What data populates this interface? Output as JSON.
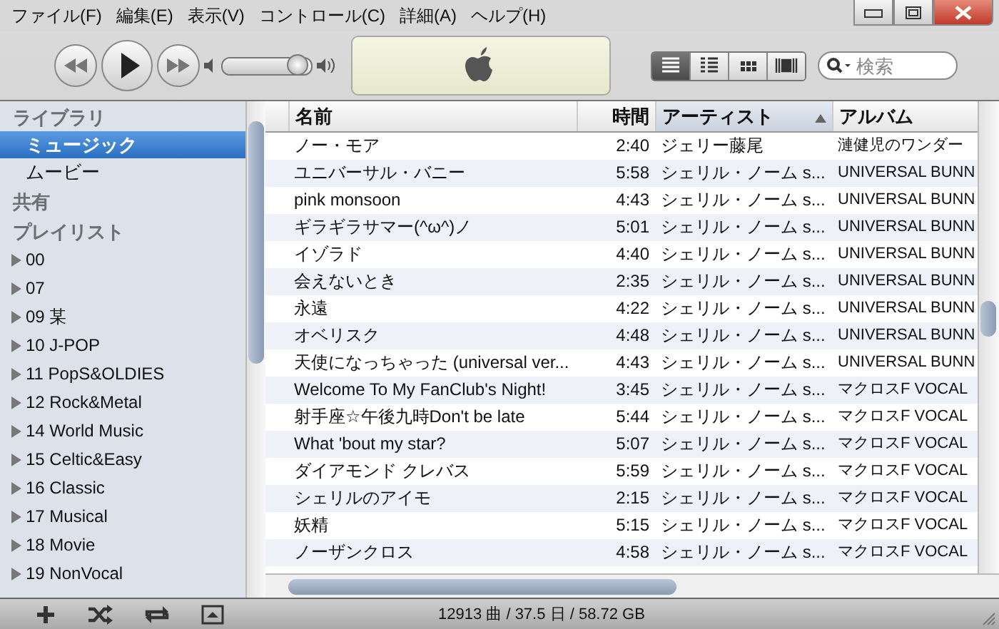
{
  "menu": [
    "ファイル(F)",
    "編集(E)",
    "表示(V)",
    "コントロール(C)",
    "詳細(A)",
    "ヘルプ(H)"
  ],
  "volume": {
    "level": 0.86
  },
  "view_buttons": [
    {
      "selected": true
    },
    {
      "selected": false
    },
    {
      "selected": false
    },
    {
      "selected": false
    }
  ],
  "search": {
    "placeholder": "検索"
  },
  "sidebar": {
    "sections": [
      {
        "title": "ライブラリ",
        "items": [
          {
            "label": "ミュージック",
            "selected": true
          },
          {
            "label": "ムービー",
            "selected": false
          }
        ]
      },
      {
        "title": "共有"
      },
      {
        "title": "プレイリスト",
        "items": [
          {
            "label": "00",
            "selected": false,
            "expanded": false
          },
          {
            "label": "07",
            "selected": false,
            "expanded": false
          },
          {
            "label": "09 某",
            "selected": false,
            "expanded": false
          },
          {
            "label": "10 J-POP",
            "selected": false,
            "expanded": false
          },
          {
            "label": "11 PopS&OLDIES",
            "selected": false,
            "expanded": false
          },
          {
            "label": "12 Rock&Metal",
            "selected": false,
            "expanded": false
          },
          {
            "label": "14 World Music",
            "selected": false,
            "expanded": false
          },
          {
            "label": "15 Celtic&Easy",
            "selected": false,
            "expanded": false
          },
          {
            "label": "16 Classic",
            "selected": false,
            "expanded": false
          },
          {
            "label": "17 Musical",
            "selected": false,
            "expanded": false
          },
          {
            "label": "18 Movie",
            "selected": false,
            "expanded": false
          },
          {
            "label": "19 NonVocal",
            "selected": false,
            "expanded": false
          }
        ]
      }
    ]
  },
  "table": {
    "columns": [
      {
        "label": "名前",
        "sorted": false
      },
      {
        "label": "時間",
        "sorted": false
      },
      {
        "label": "アーティスト",
        "sorted": true
      },
      {
        "label": "アルバム",
        "sorted": false
      }
    ],
    "rows": [
      [
        "ノー・モア",
        "2:40",
        "ジェリー藤尾",
        "漣健児のワンダー"
      ],
      [
        "ユニバーサル・バニー",
        "5:58",
        "シェリル・ノーム s...",
        "UNIVERSAL BUNN"
      ],
      [
        "pink monsoon",
        "4:43",
        "シェリル・ノーム s...",
        "UNIVERSAL BUNN"
      ],
      [
        "ギラギラサマー(^ω^)ノ",
        "5:01",
        "シェリル・ノーム s...",
        "UNIVERSAL BUNN"
      ],
      [
        "イゾラド",
        "4:40",
        "シェリル・ノーム s...",
        "UNIVERSAL BUNN"
      ],
      [
        "会えないとき",
        "2:35",
        "シェリル・ノーム s...",
        "UNIVERSAL BUNN"
      ],
      [
        "永遠",
        "4:22",
        "シェリル・ノーム s...",
        "UNIVERSAL BUNN"
      ],
      [
        "オベリスク",
        "4:48",
        "シェリル・ノーム s...",
        "UNIVERSAL BUNN"
      ],
      [
        "天使になっちゃった (universal ver...",
        "4:43",
        "シェリル・ノーム s...",
        "UNIVERSAL BUNN"
      ],
      [
        "Welcome To My FanClub's Night!",
        "3:45",
        "シェリル・ノーム s...",
        "マクロスF VOCAL"
      ],
      [
        "射手座☆午後九時Don't be late",
        "5:44",
        "シェリル・ノーム s...",
        "マクロスF VOCAL"
      ],
      [
        "What 'bout my star?",
        "5:07",
        "シェリル・ノーム s...",
        "マクロスF VOCAL"
      ],
      [
        "ダイアモンド クレバス",
        "5:59",
        "シェリル・ノーム s...",
        "マクロスF VOCAL"
      ],
      [
        "シェリルのアイモ",
        "2:15",
        "シェリル・ノーム s...",
        "マクロスF VOCAL"
      ],
      [
        "妖精",
        "5:15",
        "シェリル・ノーム s...",
        "マクロスF VOCAL"
      ],
      [
        "ノーザンクロス",
        "4:58",
        "シェリル・ノーム s...",
        "マクロスF VOCAL"
      ]
    ]
  },
  "status_bar": "12913 曲 / 37.5 日 / 58.72 GB"
}
